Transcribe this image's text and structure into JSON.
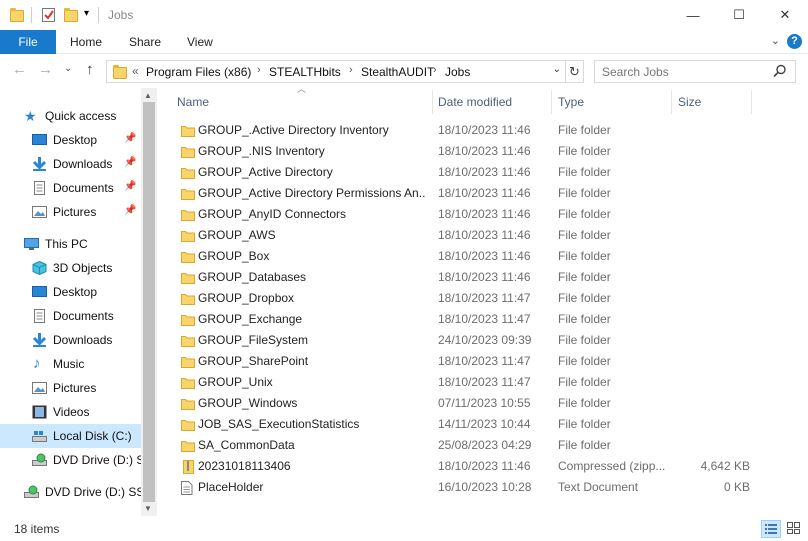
{
  "window": {
    "title": "Jobs",
    "controls": {
      "minimize": "—",
      "maximize": "☐",
      "close": "✕"
    }
  },
  "ribbon": {
    "tabs": [
      "File",
      "Home",
      "Share",
      "View"
    ],
    "help": "?",
    "expand": "⌄"
  },
  "nav": {
    "back": "←",
    "forward": "→",
    "recent": "⌄",
    "up": "↑"
  },
  "address": {
    "overflow": "«",
    "crumbs": [
      "Program Files (x86)",
      "STEALTHbits",
      "StealthAUDIT",
      "Jobs"
    ],
    "separator": "›",
    "dropdown": "⌄",
    "refresh": "↻"
  },
  "search": {
    "placeholder": "Search Jobs"
  },
  "sidebar": {
    "items": [
      {
        "label": "Quick access",
        "icon": "star-icon"
      },
      {
        "label": "Desktop",
        "icon": "desktop-icon",
        "pinned": true
      },
      {
        "label": "Downloads",
        "icon": "download-icon",
        "pinned": true
      },
      {
        "label": "Documents",
        "icon": "documents-icon",
        "pinned": true
      },
      {
        "label": "Pictures",
        "icon": "pictures-icon",
        "pinned": true
      },
      {
        "label": "This PC",
        "icon": "computer-icon"
      },
      {
        "label": "3D Objects",
        "icon": "cube-icon"
      },
      {
        "label": "Desktop",
        "icon": "desktop-icon"
      },
      {
        "label": "Documents",
        "icon": "documents-icon"
      },
      {
        "label": "Downloads",
        "icon": "download-icon"
      },
      {
        "label": "Music",
        "icon": "music-icon"
      },
      {
        "label": "Pictures",
        "icon": "pictures-icon"
      },
      {
        "label": "Videos",
        "icon": "video-icon"
      },
      {
        "label": "Local Disk (C:)",
        "icon": "disk-icon",
        "selected": true
      },
      {
        "label": "DVD Drive (D:) SSS",
        "icon": "dvd-icon"
      },
      {
        "label": "DVD Drive (D:) SSS",
        "icon": "dvd-icon"
      }
    ],
    "pin_glyph": "📌"
  },
  "columns": {
    "name": "Name",
    "date": "Date modified",
    "type": "Type",
    "size": "Size"
  },
  "files": [
    {
      "name": "GROUP_.Active Directory Inventory",
      "date": "18/10/2023 11:46",
      "type": "File folder",
      "size": "",
      "kind": "folder"
    },
    {
      "name": "GROUP_.NIS Inventory",
      "date": "18/10/2023 11:46",
      "type": "File folder",
      "size": "",
      "kind": "folder"
    },
    {
      "name": "GROUP_Active Directory",
      "date": "18/10/2023 11:46",
      "type": "File folder",
      "size": "",
      "kind": "folder"
    },
    {
      "name": "GROUP_Active Directory Permissions An...",
      "date": "18/10/2023 11:46",
      "type": "File folder",
      "size": "",
      "kind": "folder"
    },
    {
      "name": "GROUP_AnyID Connectors",
      "date": "18/10/2023 11:46",
      "type": "File folder",
      "size": "",
      "kind": "folder"
    },
    {
      "name": "GROUP_AWS",
      "date": "18/10/2023 11:46",
      "type": "File folder",
      "size": "",
      "kind": "folder"
    },
    {
      "name": "GROUP_Box",
      "date": "18/10/2023 11:46",
      "type": "File folder",
      "size": "",
      "kind": "folder"
    },
    {
      "name": "GROUP_Databases",
      "date": "18/10/2023 11:46",
      "type": "File folder",
      "size": "",
      "kind": "folder"
    },
    {
      "name": "GROUP_Dropbox",
      "date": "18/10/2023 11:47",
      "type": "File folder",
      "size": "",
      "kind": "folder"
    },
    {
      "name": "GROUP_Exchange",
      "date": "18/10/2023 11:47",
      "type": "File folder",
      "size": "",
      "kind": "folder"
    },
    {
      "name": "GROUP_FileSystem",
      "date": "24/10/2023 09:39",
      "type": "File folder",
      "size": "",
      "kind": "folder"
    },
    {
      "name": "GROUP_SharePoint",
      "date": "18/10/2023 11:47",
      "type": "File folder",
      "size": "",
      "kind": "folder"
    },
    {
      "name": "GROUP_Unix",
      "date": "18/10/2023 11:47",
      "type": "File folder",
      "size": "",
      "kind": "folder"
    },
    {
      "name": "GROUP_Windows",
      "date": "07/11/2023 10:55",
      "type": "File folder",
      "size": "",
      "kind": "folder"
    },
    {
      "name": "JOB_SAS_ExecutionStatistics",
      "date": "14/11/2023 10:44",
      "type": "File folder",
      "size": "",
      "kind": "folder"
    },
    {
      "name": "SA_CommonData",
      "date": "25/08/2023 04:29",
      "type": "File folder",
      "size": "",
      "kind": "folder"
    },
    {
      "name": "20231018113406",
      "date": "18/10/2023 11:46",
      "type": "Compressed (zipp...",
      "size": "4,642 KB",
      "kind": "zip"
    },
    {
      "name": "PlaceHolder",
      "date": "16/10/2023 10:28",
      "type": "Text Document",
      "size": "0 KB",
      "kind": "text"
    }
  ],
  "status": {
    "count": "18 items"
  },
  "colors": {
    "accent": "#1979ca",
    "folder": "#f7d56a",
    "selection": "#cce8ff",
    "header_text": "#4c607a"
  }
}
